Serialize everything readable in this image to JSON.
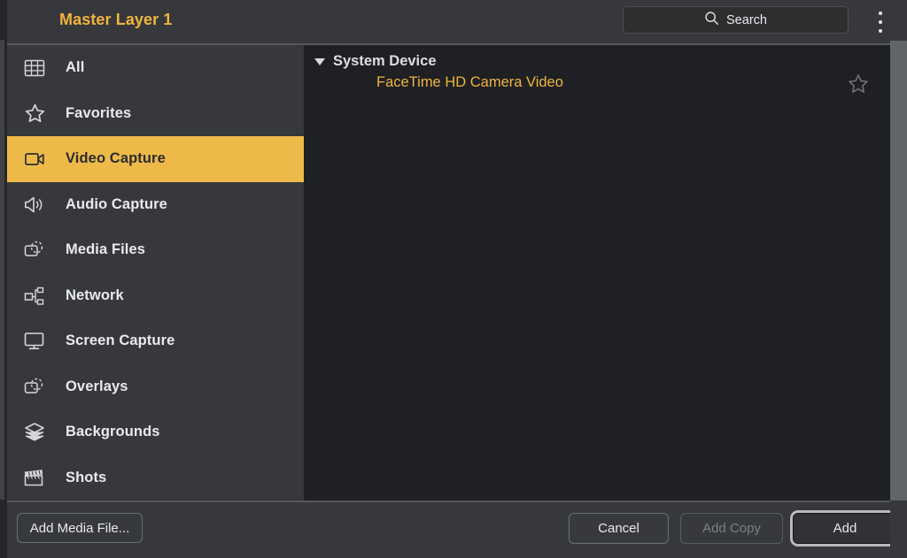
{
  "window": {
    "title": "Master Layer 1",
    "accent_color": "#f0b43f",
    "highlight_color": "#edba4a",
    "sidebar_bg": "#36383b",
    "content_bg": "#1e2023"
  },
  "header": {
    "title": "Master Layer 1",
    "search": {
      "placeholder": "Search",
      "value": "",
      "icon": "search-icon"
    },
    "menu_icon": "kebab-menu-icon"
  },
  "sidebar": {
    "items": [
      {
        "label": "All",
        "icon": "grid-icon",
        "selected": false
      },
      {
        "label": "Favorites",
        "icon": "star-icon",
        "selected": false
      },
      {
        "label": "Video Capture",
        "icon": "video-camera-icon",
        "selected": true
      },
      {
        "label": "Audio Capture",
        "icon": "speaker-icon",
        "selected": false
      },
      {
        "label": "Media Files",
        "icon": "media-file-icon",
        "selected": false
      },
      {
        "label": "Network",
        "icon": "network-nodes-icon",
        "selected": false
      },
      {
        "label": "Screen Capture",
        "icon": "monitor-icon",
        "selected": false
      },
      {
        "label": "Overlays",
        "icon": "overlay-icon",
        "selected": false
      },
      {
        "label": "Backgrounds",
        "icon": "layers-icon",
        "selected": false
      },
      {
        "label": "Shots",
        "icon": "clapperboard-icon",
        "selected": false
      }
    ]
  },
  "content": {
    "groups": [
      {
        "label": "System Device",
        "expanded": true,
        "disclosure_icon": "triangle-down-icon",
        "items": [
          {
            "label": "FaceTime HD Camera Video",
            "favorite": false,
            "favorite_icon": "star-outline-icon"
          }
        ]
      }
    ]
  },
  "footer": {
    "add_media_label": "Add Media File...",
    "cancel_label": "Cancel",
    "add_copy_label": "Add Copy",
    "add_copy_enabled": false,
    "add_label": "Add",
    "add_is_default": true
  }
}
